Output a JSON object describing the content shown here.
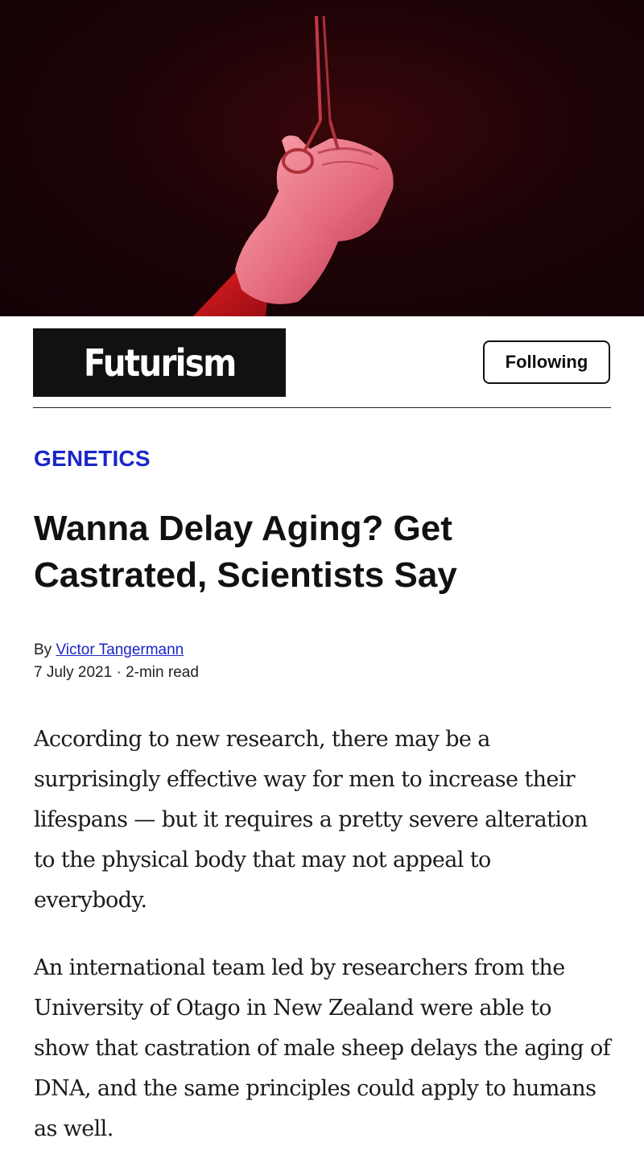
{
  "header": {
    "brand": "Futurism",
    "follow_label": "Following"
  },
  "article": {
    "category": "GENETICS",
    "headline": "Wanna Delay Aging? Get Castrated, Scientists Say",
    "byline_prefix": "By",
    "author": "Victor Tangermann",
    "date": "7 July 2021",
    "separator": "·",
    "read_time": "2-min read",
    "paragraphs": [
      "According to new research, there may be a surprisingly effective way for men to increase their lifespans — but it requires a pretty severe alteration to the physical body that may not appeal to everybody.",
      "An international team led by researchers from the University of Otago in New Zealand were able to show that castration of male sheep delays the aging of DNA, and the same principles could apply to humans as well."
    ]
  },
  "colors": {
    "accent": "#1a25c9",
    "hero_bg": "#160306",
    "glove": "#e87080"
  }
}
